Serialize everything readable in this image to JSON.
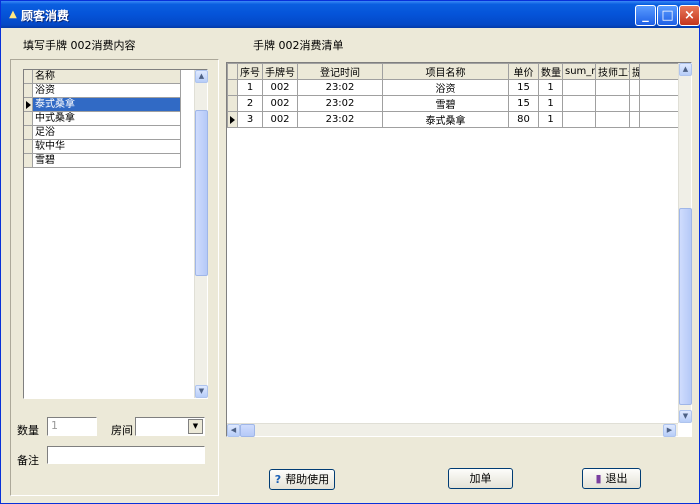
{
  "window": {
    "title": "顾客消费"
  },
  "left": {
    "caption": "填写手牌 002消费内容",
    "list_header": "名称",
    "items": [
      "浴资",
      "泰式桑拿",
      "中式桑拿",
      "足浴",
      "软中华",
      "雪碧"
    ],
    "selected_index": 1,
    "quantity_label": "数量",
    "quantity_value": "1",
    "room_label": "房间",
    "room_value": "",
    "remark_label": "备注",
    "remark_value": ""
  },
  "right": {
    "caption": "手牌 002消费清单",
    "columns": [
      "序号",
      "手牌号",
      "登记时间",
      "项目名称",
      "单价",
      "数量",
      "sum_money",
      "技师工号",
      "提成"
    ],
    "rows": [
      [
        "1",
        "002",
        "23:02",
        "浴资",
        "15",
        "1",
        "",
        "",
        ""
      ],
      [
        "2",
        "002",
        "23:02",
        "雪碧",
        "15",
        "1",
        "",
        "",
        ""
      ],
      [
        "3",
        "002",
        "23:02",
        "泰式桑拿",
        "80",
        "1",
        "",
        "",
        ""
      ]
    ],
    "current_row": 2
  },
  "buttons": {
    "help": "帮助使用",
    "add": "加单",
    "exit": "退出"
  },
  "icons": {
    "help": "question-icon",
    "exit": "door-exit-icon"
  }
}
